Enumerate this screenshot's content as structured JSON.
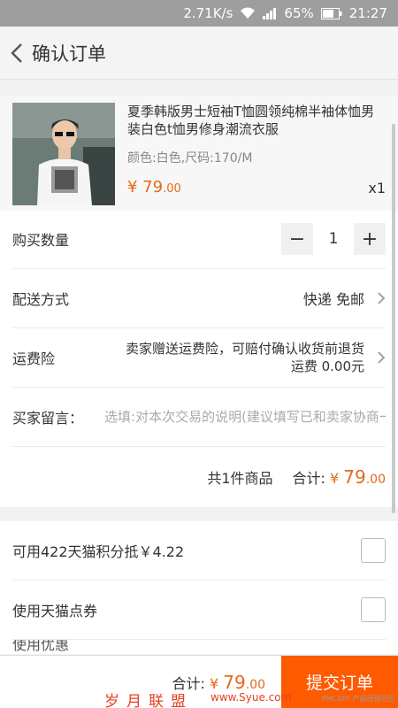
{
  "status_bar": {
    "speed": "2.71K/s",
    "battery": "65%",
    "time": "21:27"
  },
  "nav": {
    "title": "确认订单"
  },
  "product": {
    "name": "夏季韩版男士短袖T恤圆领纯棉半袖体恤男装白色t恤男修身潮流衣服",
    "spec": "颜色:白色,尺码:170/M",
    "price_symbol": "¥",
    "price_int": "79",
    "price_dec": ".00",
    "qty": "x1"
  },
  "order": {
    "qty_label": "购买数量",
    "qty_value": "1",
    "minus": "−",
    "plus": "+",
    "delivery_label": "配送方式",
    "delivery_value": "快递 免邮",
    "insurance_label": "运费险",
    "insurance_line1": "卖家赠送运费险，可赔付确认收货前退货",
    "insurance_line2": "运费 0.00元",
    "message_label": "买家留言：",
    "message_placeholder": "选填:对本次交易的说明(建议填写已和卖家协商一致的内容)",
    "count_text": "共1件商品",
    "total_label": "合计:",
    "total_symbol": "¥",
    "total_int": "79",
    "total_dec": ".00"
  },
  "benefits": {
    "points_label": "可用422天猫积分抵￥4.22",
    "coupon_label": "使用天猫点券",
    "partial_label": "使用优惠"
  },
  "bottom_bar": {
    "total_label": "合计:",
    "total_symbol": "¥",
    "total_int": "79",
    "total_dec": ".00",
    "submit_label": "提交订单"
  },
  "watermark": {
    "left": "岁月联盟",
    "mid": "www.Syue.com",
    "right": "PMCAFF 产品经理社区"
  },
  "colors": {
    "accent": "#ff5a00",
    "price": "#e36b1a",
    "status_bar": "#9e9e9e"
  }
}
